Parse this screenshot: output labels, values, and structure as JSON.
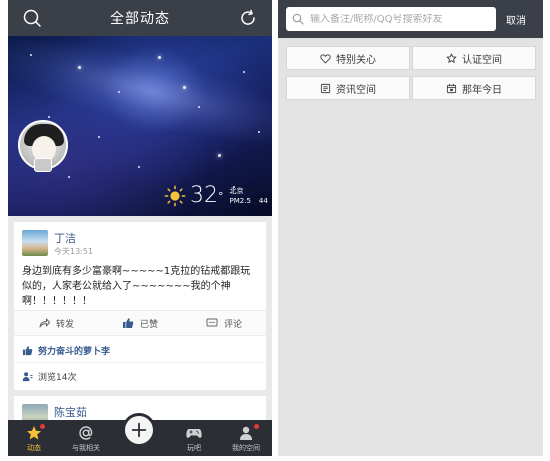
{
  "feed": {
    "header": {
      "title": "全部动态"
    },
    "weather": {
      "temperature": "32",
      "degree": "°",
      "city": "北京",
      "pm_label": "PM2.5",
      "pm_value": "44"
    },
    "posts": [
      {
        "author": "丁洁",
        "time": "今天13:51",
        "text": "身边到底有多少富豪啊~~~~~1克拉的钻戒都跟玩似的，人家老公就给入了~~~~~~~我的个神啊！！！！！！",
        "actions": {
          "forward": "转发",
          "liked": "已赞",
          "comment": "评论"
        },
        "liked_by": "努力奋斗的萝卜李",
        "views": "浏览14次"
      },
      {
        "author": "陈宝茹"
      }
    ],
    "tabbar": {
      "items": [
        {
          "label": "动态"
        },
        {
          "label": "与我相关"
        },
        {
          "label": "玩吧"
        },
        {
          "label": "我的空间"
        }
      ]
    },
    "colors": {
      "header_bg": "#3b3f48",
      "tabbar_bg": "#2b2e35",
      "active_tab": "#f7c13d",
      "link": "#375a8f"
    }
  },
  "search": {
    "placeholder": "输入备注/昵称/QQ号搜索好友",
    "cancel": "取消",
    "categories": [
      {
        "label": "特别关心",
        "icon": "heart-icon"
      },
      {
        "label": "认证空间",
        "icon": "star-badge-icon"
      },
      {
        "label": "资讯空间",
        "icon": "news-icon"
      },
      {
        "label": "那年今日",
        "icon": "calendar-icon"
      }
    ]
  }
}
